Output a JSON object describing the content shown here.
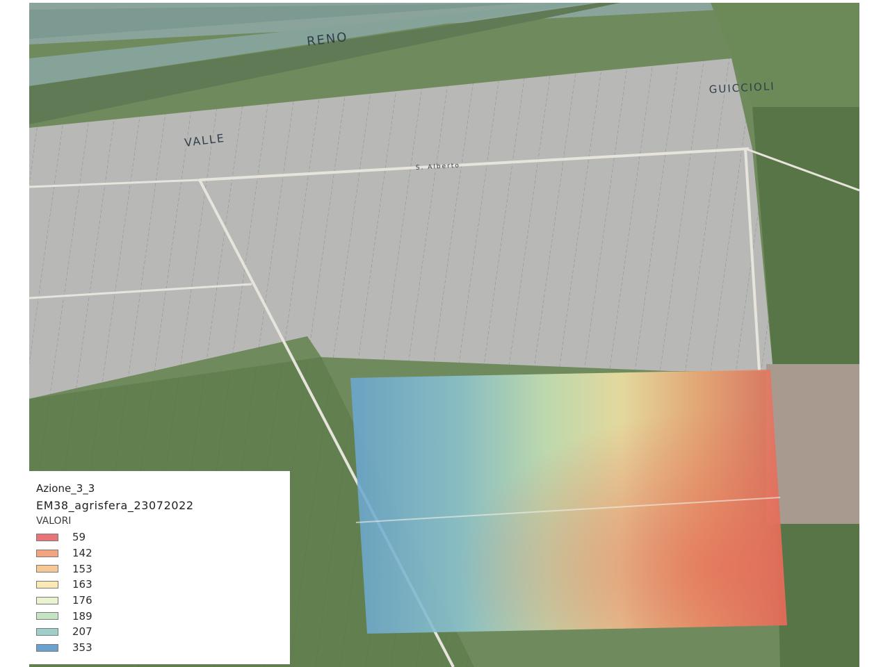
{
  "map": {
    "labels": {
      "river": "RENO",
      "valle": "VALLE",
      "guiccioli": "GUICCIOLI",
      "road": "S. Alberto"
    },
    "colors": {
      "water": "#7d9a92",
      "field_gray": "#b8b8b6",
      "field_green": "#6f8a5c",
      "vegetation": "#587548",
      "road": "#e6e4dc"
    }
  },
  "legend": {
    "layer": "Azione_3_3",
    "sublayer": "EM38_agrisfera_23072022",
    "field": "VALORI",
    "items": [
      {
        "value": "59",
        "color": "#e8747a"
      },
      {
        "value": "142",
        "color": "#f3a37f"
      },
      {
        "value": "153",
        "color": "#f7c796"
      },
      {
        "value": "163",
        "color": "#fbe9b5"
      },
      {
        "value": "176",
        "color": "#eaf3cf"
      },
      {
        "value": "189",
        "color": "#c4e4c4"
      },
      {
        "value": "207",
        "color": "#9fcfcb"
      },
      {
        "value": "353",
        "color": "#6aa1cf"
      }
    ]
  }
}
